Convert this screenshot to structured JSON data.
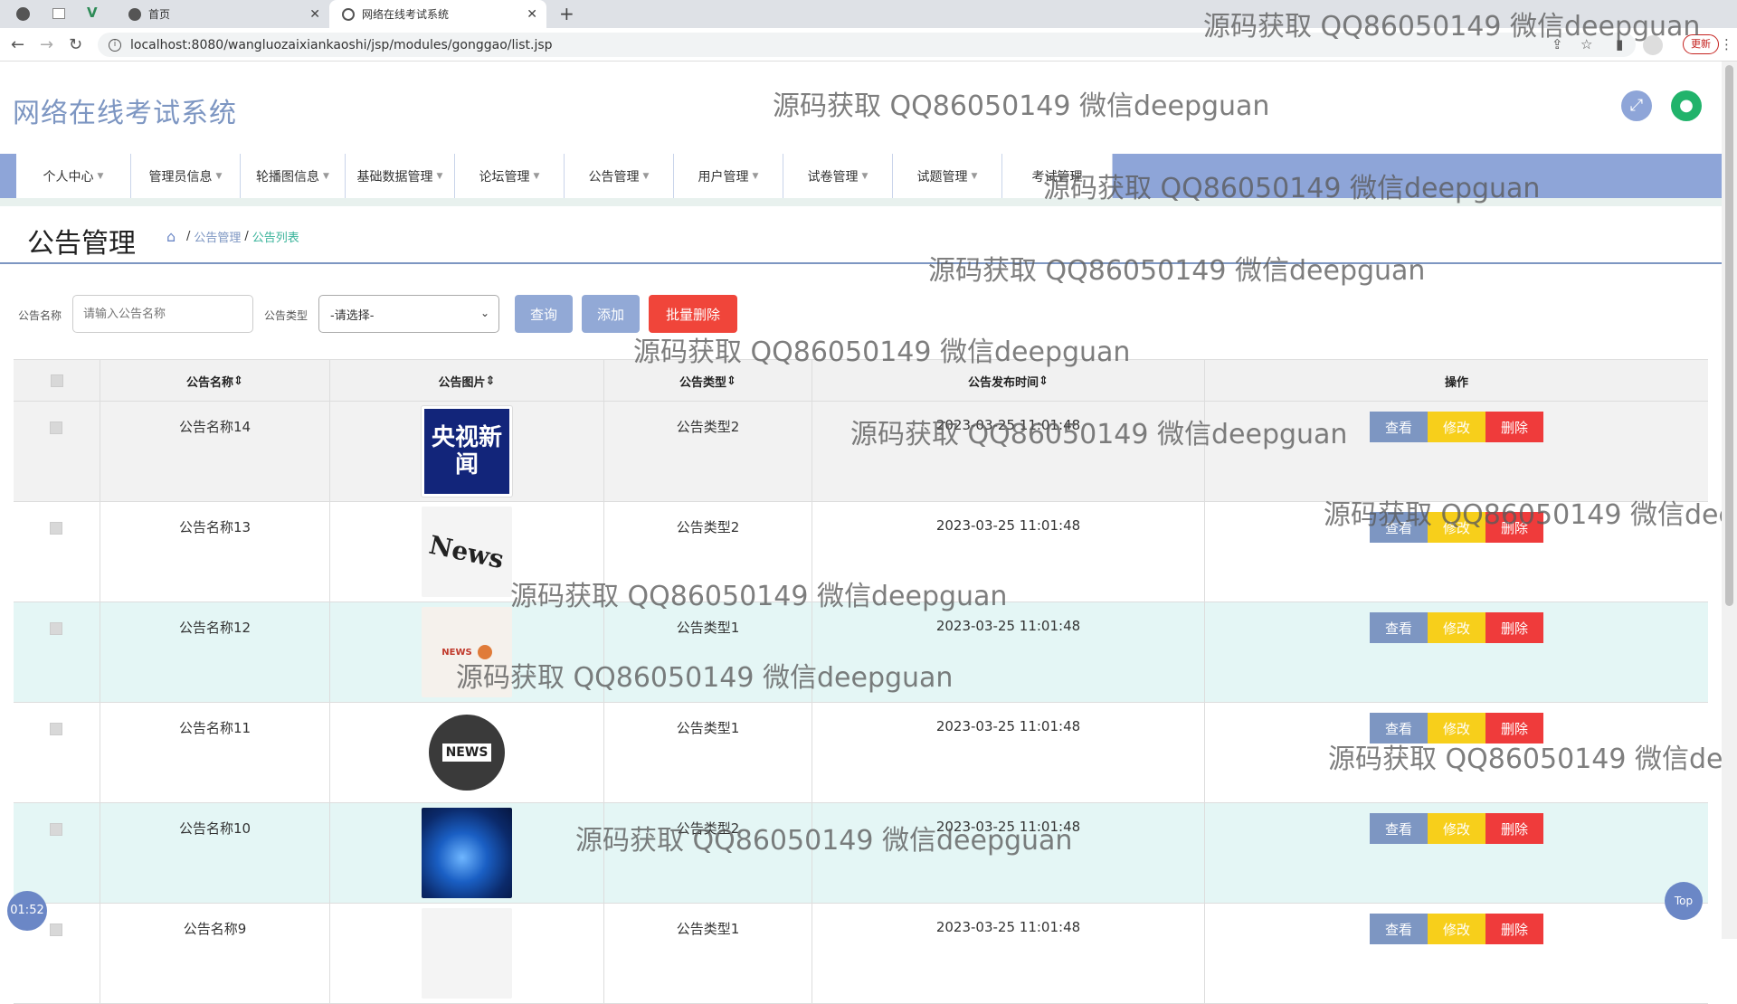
{
  "browser": {
    "tabs": [
      {
        "title": "首页"
      },
      {
        "title": "网络在线考试系统"
      }
    ],
    "new_tab": "+",
    "url": "localhost:8080/wangluozaixiankaoshi/jsp/modules/gonggao/list.jsp",
    "update_label": "更新"
  },
  "app": {
    "title": "网络在线考试系统",
    "menu": [
      {
        "label": "个人中心"
      },
      {
        "label": "管理员信息"
      },
      {
        "label": "轮播图信息"
      },
      {
        "label": "基础数据管理"
      },
      {
        "label": "论坛管理"
      },
      {
        "label": "公告管理"
      },
      {
        "label": "用户管理"
      },
      {
        "label": "试卷管理"
      },
      {
        "label": "试题管理"
      },
      {
        "label": "考试管理"
      }
    ]
  },
  "page": {
    "title": "公告管理",
    "breadcrumb": [
      "公告管理",
      "公告列表"
    ],
    "separator": "/"
  },
  "search": {
    "name_label": "公告名称",
    "name_placeholder": "请输入公告名称",
    "type_label": "公告类型",
    "type_selected": "-请选择-",
    "query_label": "查询",
    "add_label": "添加",
    "batch_delete_label": "批量删除"
  },
  "table": {
    "columns": [
      "公告名称",
      "公告图片",
      "公告类型",
      "公告发布时间",
      "操作"
    ],
    "actions": {
      "view": "查看",
      "edit": "修改",
      "delete": "删除"
    },
    "rows": [
      {
        "name": "公告名称14",
        "type": "公告类型2",
        "time": "2023-03-25 11:01:48",
        "image": "cctv-news",
        "img_text": "央视新闻"
      },
      {
        "name": "公告名称13",
        "type": "公告类型2",
        "time": "2023-03-25 11:01:48",
        "image": "newspaper",
        "img_text": "News"
      },
      {
        "name": "公告名称12",
        "type": "公告类型1",
        "time": "2023-03-25 11:01:48",
        "image": "news-illustration",
        "img_text": "NEWS"
      },
      {
        "name": "公告名称11",
        "type": "公告类型1",
        "time": "2023-03-25 11:01:48",
        "image": "news-globe-badge",
        "img_text": "NEWS"
      },
      {
        "name": "公告名称10",
        "type": "公告类型2",
        "time": "2023-03-25 11:01:48",
        "image": "blue-globe",
        "img_text": ""
      },
      {
        "name": "公告名称9",
        "type": "公告类型1",
        "time": "2023-03-25 11:01:48",
        "image": "newspaper",
        "img_text": ""
      }
    ]
  },
  "watermark": "源码获取 QQ86050149 微信deepguan",
  "timer": "01:52",
  "top_button": "Top",
  "colors": {
    "accent": "#7d96c2",
    "menu_bg": "#8ea5d8",
    "btn_view": "#7d96c2",
    "btn_edit": "#f7cf1b",
    "btn_delete": "#ef3b3b",
    "row_highlight": "#e4f6f5"
  }
}
